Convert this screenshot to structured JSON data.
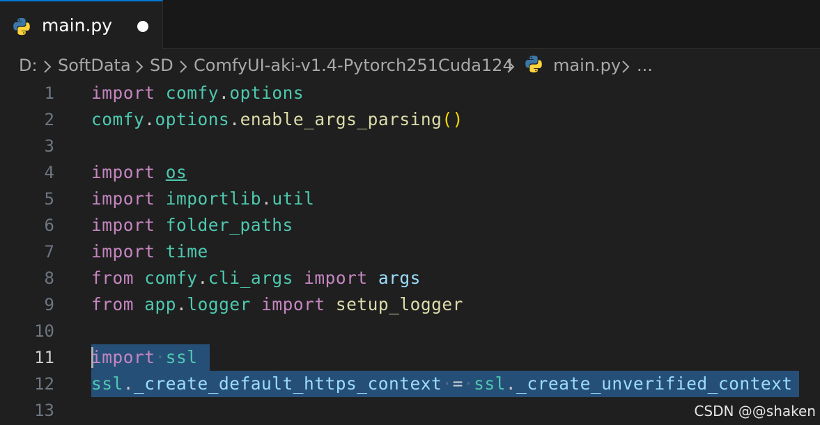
{
  "tab": {
    "filename": "main.py",
    "icon": "python-icon",
    "modified": true
  },
  "breadcrumb": {
    "segments": [
      "D:",
      "SoftData",
      "SD",
      "ComfyUI-aki-v1.4-Pytorch251Cuda124",
      "main.py",
      "..."
    ],
    "separator_icon": "chevron-right-icon"
  },
  "editor": {
    "line_numbers": [
      "1",
      "2",
      "3",
      "4",
      "5",
      "6",
      "7",
      "8",
      "9",
      "10",
      "11",
      "12",
      "13"
    ],
    "active_line": "11",
    "lines": [
      [
        {
          "t": "import",
          "c": "kw"
        },
        {
          "t": " ",
          "c": "pun"
        },
        {
          "t": "comfy",
          "c": "mod"
        },
        {
          "t": ".",
          "c": "pun"
        },
        {
          "t": "options",
          "c": "mod"
        }
      ],
      [
        {
          "t": "comfy",
          "c": "mod"
        },
        {
          "t": ".",
          "c": "pun"
        },
        {
          "t": "options",
          "c": "mod"
        },
        {
          "t": ".",
          "c": "pun"
        },
        {
          "t": "enable_args_parsing",
          "c": "fn"
        },
        {
          "t": "()",
          "c": "paren"
        }
      ],
      [],
      [
        {
          "t": "import",
          "c": "kw"
        },
        {
          "t": " ",
          "c": "pun"
        },
        {
          "t": "os",
          "c": "link"
        }
      ],
      [
        {
          "t": "import",
          "c": "kw"
        },
        {
          "t": " ",
          "c": "pun"
        },
        {
          "t": "importlib",
          "c": "mod"
        },
        {
          "t": ".",
          "c": "pun"
        },
        {
          "t": "util",
          "c": "mod"
        }
      ],
      [
        {
          "t": "import",
          "c": "kw"
        },
        {
          "t": " ",
          "c": "pun"
        },
        {
          "t": "folder_paths",
          "c": "mod"
        }
      ],
      [
        {
          "t": "import",
          "c": "kw"
        },
        {
          "t": " ",
          "c": "pun"
        },
        {
          "t": "time",
          "c": "mod"
        }
      ],
      [
        {
          "t": "from",
          "c": "kw"
        },
        {
          "t": " ",
          "c": "pun"
        },
        {
          "t": "comfy",
          "c": "mod"
        },
        {
          "t": ".",
          "c": "pun"
        },
        {
          "t": "cli_args",
          "c": "mod"
        },
        {
          "t": " ",
          "c": "pun"
        },
        {
          "t": "import",
          "c": "kw"
        },
        {
          "t": " ",
          "c": "pun"
        },
        {
          "t": "args",
          "c": "var"
        }
      ],
      [
        {
          "t": "from",
          "c": "kw"
        },
        {
          "t": " ",
          "c": "pun"
        },
        {
          "t": "app",
          "c": "mod"
        },
        {
          "t": ".",
          "c": "pun"
        },
        {
          "t": "logger",
          "c": "mod"
        },
        {
          "t": " ",
          "c": "pun"
        },
        {
          "t": "import",
          "c": "kw"
        },
        {
          "t": " ",
          "c": "pun"
        },
        {
          "t": "setup_logger",
          "c": "fn"
        }
      ],
      [],
      [
        {
          "t": "import",
          "c": "kw"
        },
        {
          "t": "·",
          "c": "ws"
        },
        {
          "t": "ssl",
          "c": "mod"
        }
      ],
      [
        {
          "t": "ssl",
          "c": "mod"
        },
        {
          "t": ".",
          "c": "pun"
        },
        {
          "t": "_create_default_https_context",
          "c": "var"
        },
        {
          "t": "·",
          "c": "ws"
        },
        {
          "t": "=",
          "c": "pun"
        },
        {
          "t": "·",
          "c": "ws"
        },
        {
          "t": "ssl",
          "c": "mod"
        },
        {
          "t": ".",
          "c": "pun"
        },
        {
          "t": "_create_unverified_context",
          "c": "var"
        }
      ],
      []
    ]
  },
  "watermark": "CSDN @@shaken"
}
